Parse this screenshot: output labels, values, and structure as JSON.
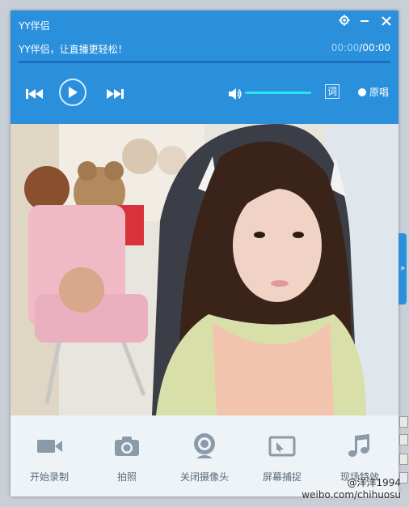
{
  "window": {
    "title": "YY伴侣",
    "subtitle": "YY伴侣，让直播更轻松！",
    "time_current": "00:00",
    "time_separator": "/",
    "time_total": "00:00",
    "lyric_label": "词",
    "original_label": "原唱"
  },
  "toolbar": {
    "items": [
      {
        "label": "开始录制",
        "icon": "video-camera-icon"
      },
      {
        "label": "拍照",
        "icon": "photo-camera-icon"
      },
      {
        "label": "关闭摄像头",
        "icon": "webcam-icon"
      },
      {
        "label": "屏幕捕捉",
        "icon": "screen-capture-icon"
      },
      {
        "label": "现场特效",
        "icon": "music-note-icon"
      }
    ]
  },
  "side_handle_label": "»",
  "watermark": "@洋洋1994\nweibo.com/chihuosu",
  "colors": {
    "header_blue": "#2b90dc",
    "volume_cyan": "#28e3f2",
    "toolbar_bg": "#eef3f7",
    "toolbar_icon": "#8b9aa8"
  }
}
